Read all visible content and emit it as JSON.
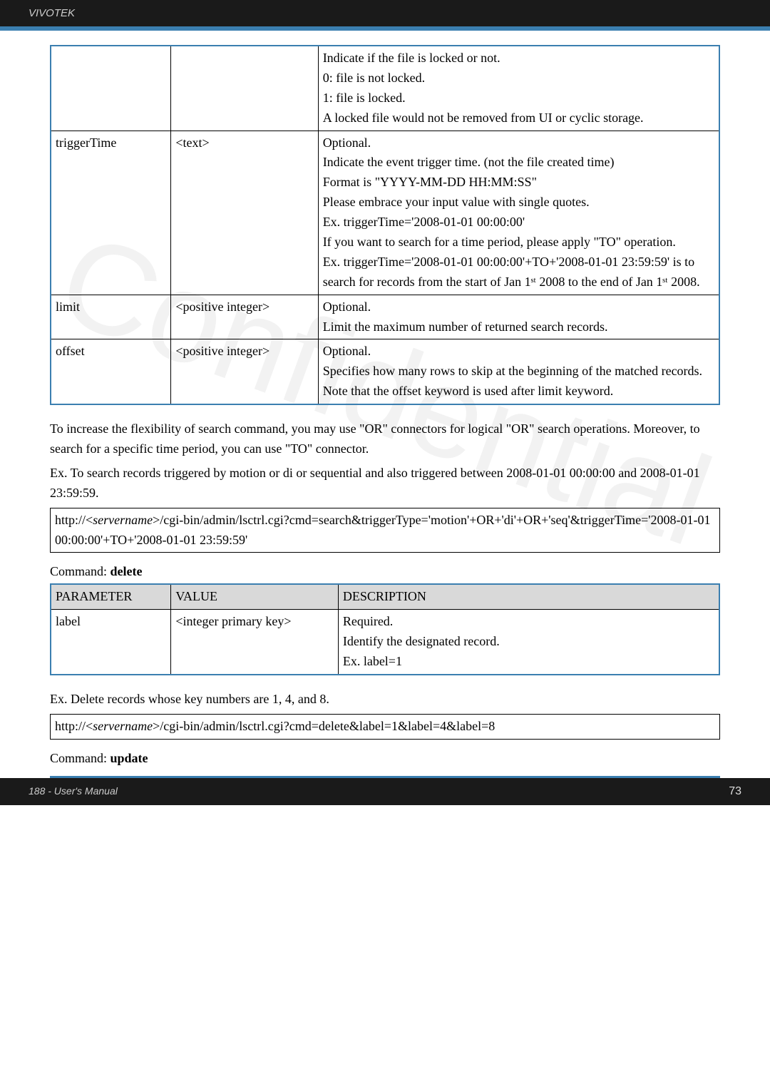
{
  "header": {
    "brand": "VIVOTEK"
  },
  "watermark": "Confidential",
  "table1": {
    "rows": [
      {
        "param": "",
        "value": "",
        "desc": "Indicate if the file is locked or not.\n0: file is not locked.\n1: file is locked.\nA locked file would not be removed from UI or cyclic storage."
      },
      {
        "param": "triggerTime",
        "value": "<text>",
        "desc": "Optional.\nIndicate the event trigger time. (not the file created time)\nFormat is \"YYYY-MM-DD HH:MM:SS\"\nPlease embrace your input value with single quotes.\nEx. triggerTime='2008-01-01 00:00:00'\nIf you want to search for a time period, please apply \"TO\" operation.\nEx. triggerTime='2008-01-01 00:00:00'+TO+'2008-01-01 23:59:59' is to search for records from the start of Jan 1ˢᵗ 2008 to the end of Jan 1ˢᵗ 2008."
      },
      {
        "param": "limit",
        "value": "<positive integer>",
        "desc": "Optional.\nLimit the maximum number of returned search records."
      },
      {
        "param": "offset",
        "value": "<positive integer>",
        "desc": "Optional.\nSpecifies how many rows to skip at the beginning of the matched records.\nNote that the offset keyword is used after limit keyword."
      }
    ]
  },
  "paragraphs": {
    "p1": "To increase the flexibility of search command, you may use \"OR\" connectors for logical \"OR\" search operations. Moreover, to search for a specific time period, you can use \"TO\" connector.",
    "p2": "Ex. To search records triggered by motion or di or sequential and also triggered between 2008-01-01 00:00:00 and 2008-01-01 23:59:59."
  },
  "url1_a": "http://<",
  "url1_server": "servername",
  "url1_b": ">/cgi-bin/admin/lsctrl.cgi?cmd=search&triggerType='motion'+OR+'di'+OR+'seq'&triggerTime='2008-01-01 00:00:00'+TO+'2008-01-01 23:59:59'",
  "deleteCmd": {
    "label_prefix": "Command: ",
    "label": "delete",
    "headers": [
      "PARAMETER",
      "VALUE",
      "DESCRIPTION"
    ],
    "row": {
      "param": "label",
      "value": "<integer primary key>",
      "desc": "Required.\nIdentify the designated record.\nEx. label=1"
    }
  },
  "exDelete": "Ex. Delete records whose key numbers are 1, 4, and 8.",
  "url2_a": "http://<",
  "url2_server": "servername",
  "url2_b": ">/cgi-bin/admin/lsctrl.cgi?cmd=delete&label=1&label=4&label=8",
  "updateCmd": {
    "label_prefix": "Command: ",
    "label": "update"
  },
  "footer": {
    "left": "188 - User's Manual",
    "page": "73"
  }
}
